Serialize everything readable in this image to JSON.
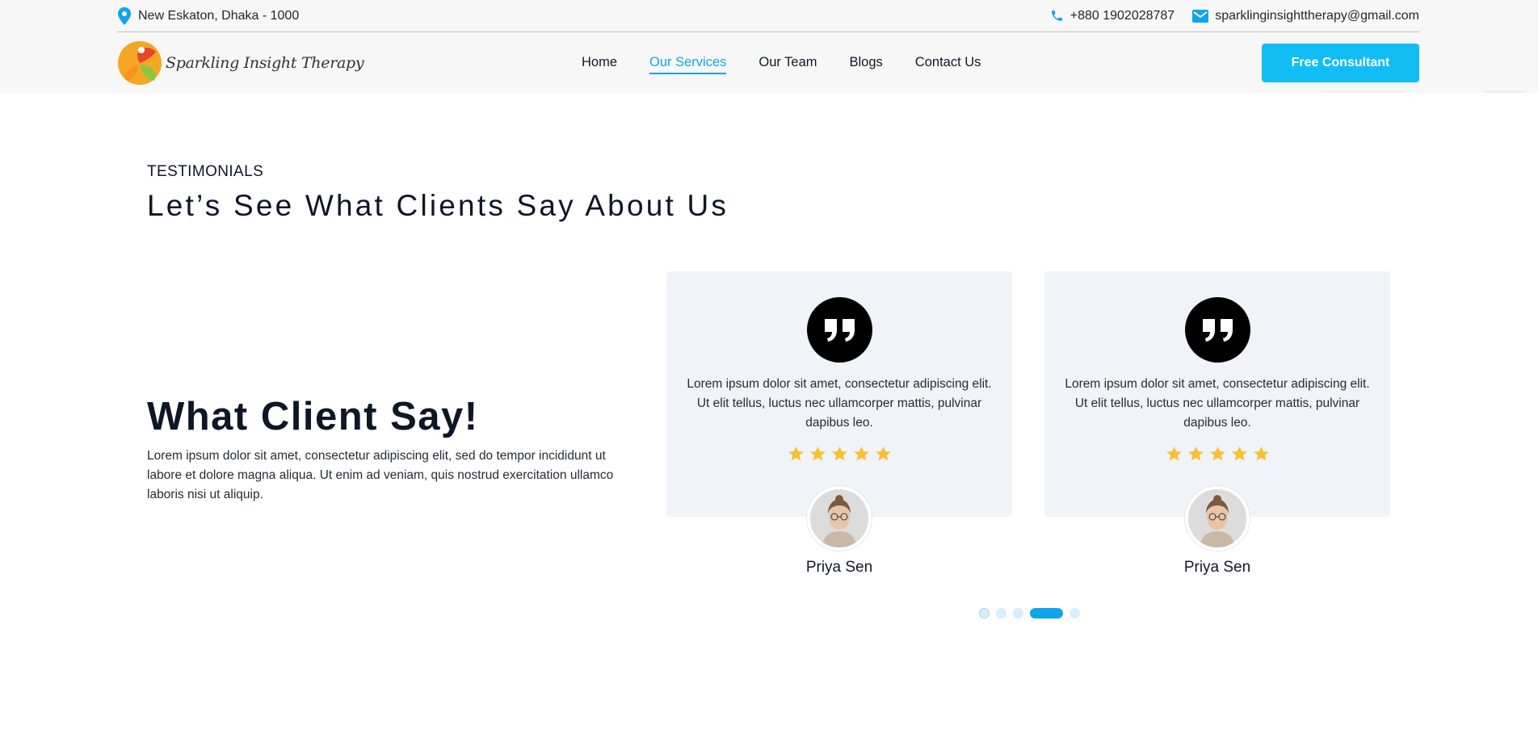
{
  "topbar": {
    "address": "New Eskaton, Dhaka - 1000",
    "phone": "+880 1902028787",
    "email": "sparklinginsighttherapy@gmail.com"
  },
  "brand": {
    "name": "Sparkling Insight Therapy"
  },
  "nav": {
    "items": [
      {
        "label": "Home"
      },
      {
        "label": "Our Services",
        "active": true
      },
      {
        "label": "Our Team"
      },
      {
        "label": "Blogs"
      },
      {
        "label": "Contact Us"
      }
    ],
    "cta_label": "Free Consultant"
  },
  "testimonials": {
    "eyebrow": "TESTIMONIALS",
    "title": "Let’s See What Clients Say About Us",
    "intro_title": "What Client Say!",
    "intro_text": "Lorem ipsum dolor sit amet, consectetur adipiscing elit, sed do tempor incididunt ut labore et dolore magna aliqua. Ut enim ad veniam, quis nostrud exercitation ullamco laboris nisi ut aliquip.",
    "cards": [
      {
        "text": "Lorem ipsum dolor sit amet, consectetur adipiscing elit. Ut elit tellus, luctus nec ullamcorper mattis, pulvinar dapibus leo.",
        "rating": 5,
        "name": "Priya Sen"
      },
      {
        "text": "Lorem ipsum dolor sit amet, consectetur adipiscing elit. Ut elit tellus, luctus nec ullamcorper mattis, pulvinar dapibus leo.",
        "rating": 5,
        "name": "Priya Sen"
      }
    ],
    "pagination": {
      "count": 5,
      "active_index": 3
    }
  },
  "colors": {
    "accent": "#12bdf5",
    "nav_active": "#11a5e8",
    "star": "#f8c035",
    "card_bg": "#f0f4f8"
  }
}
